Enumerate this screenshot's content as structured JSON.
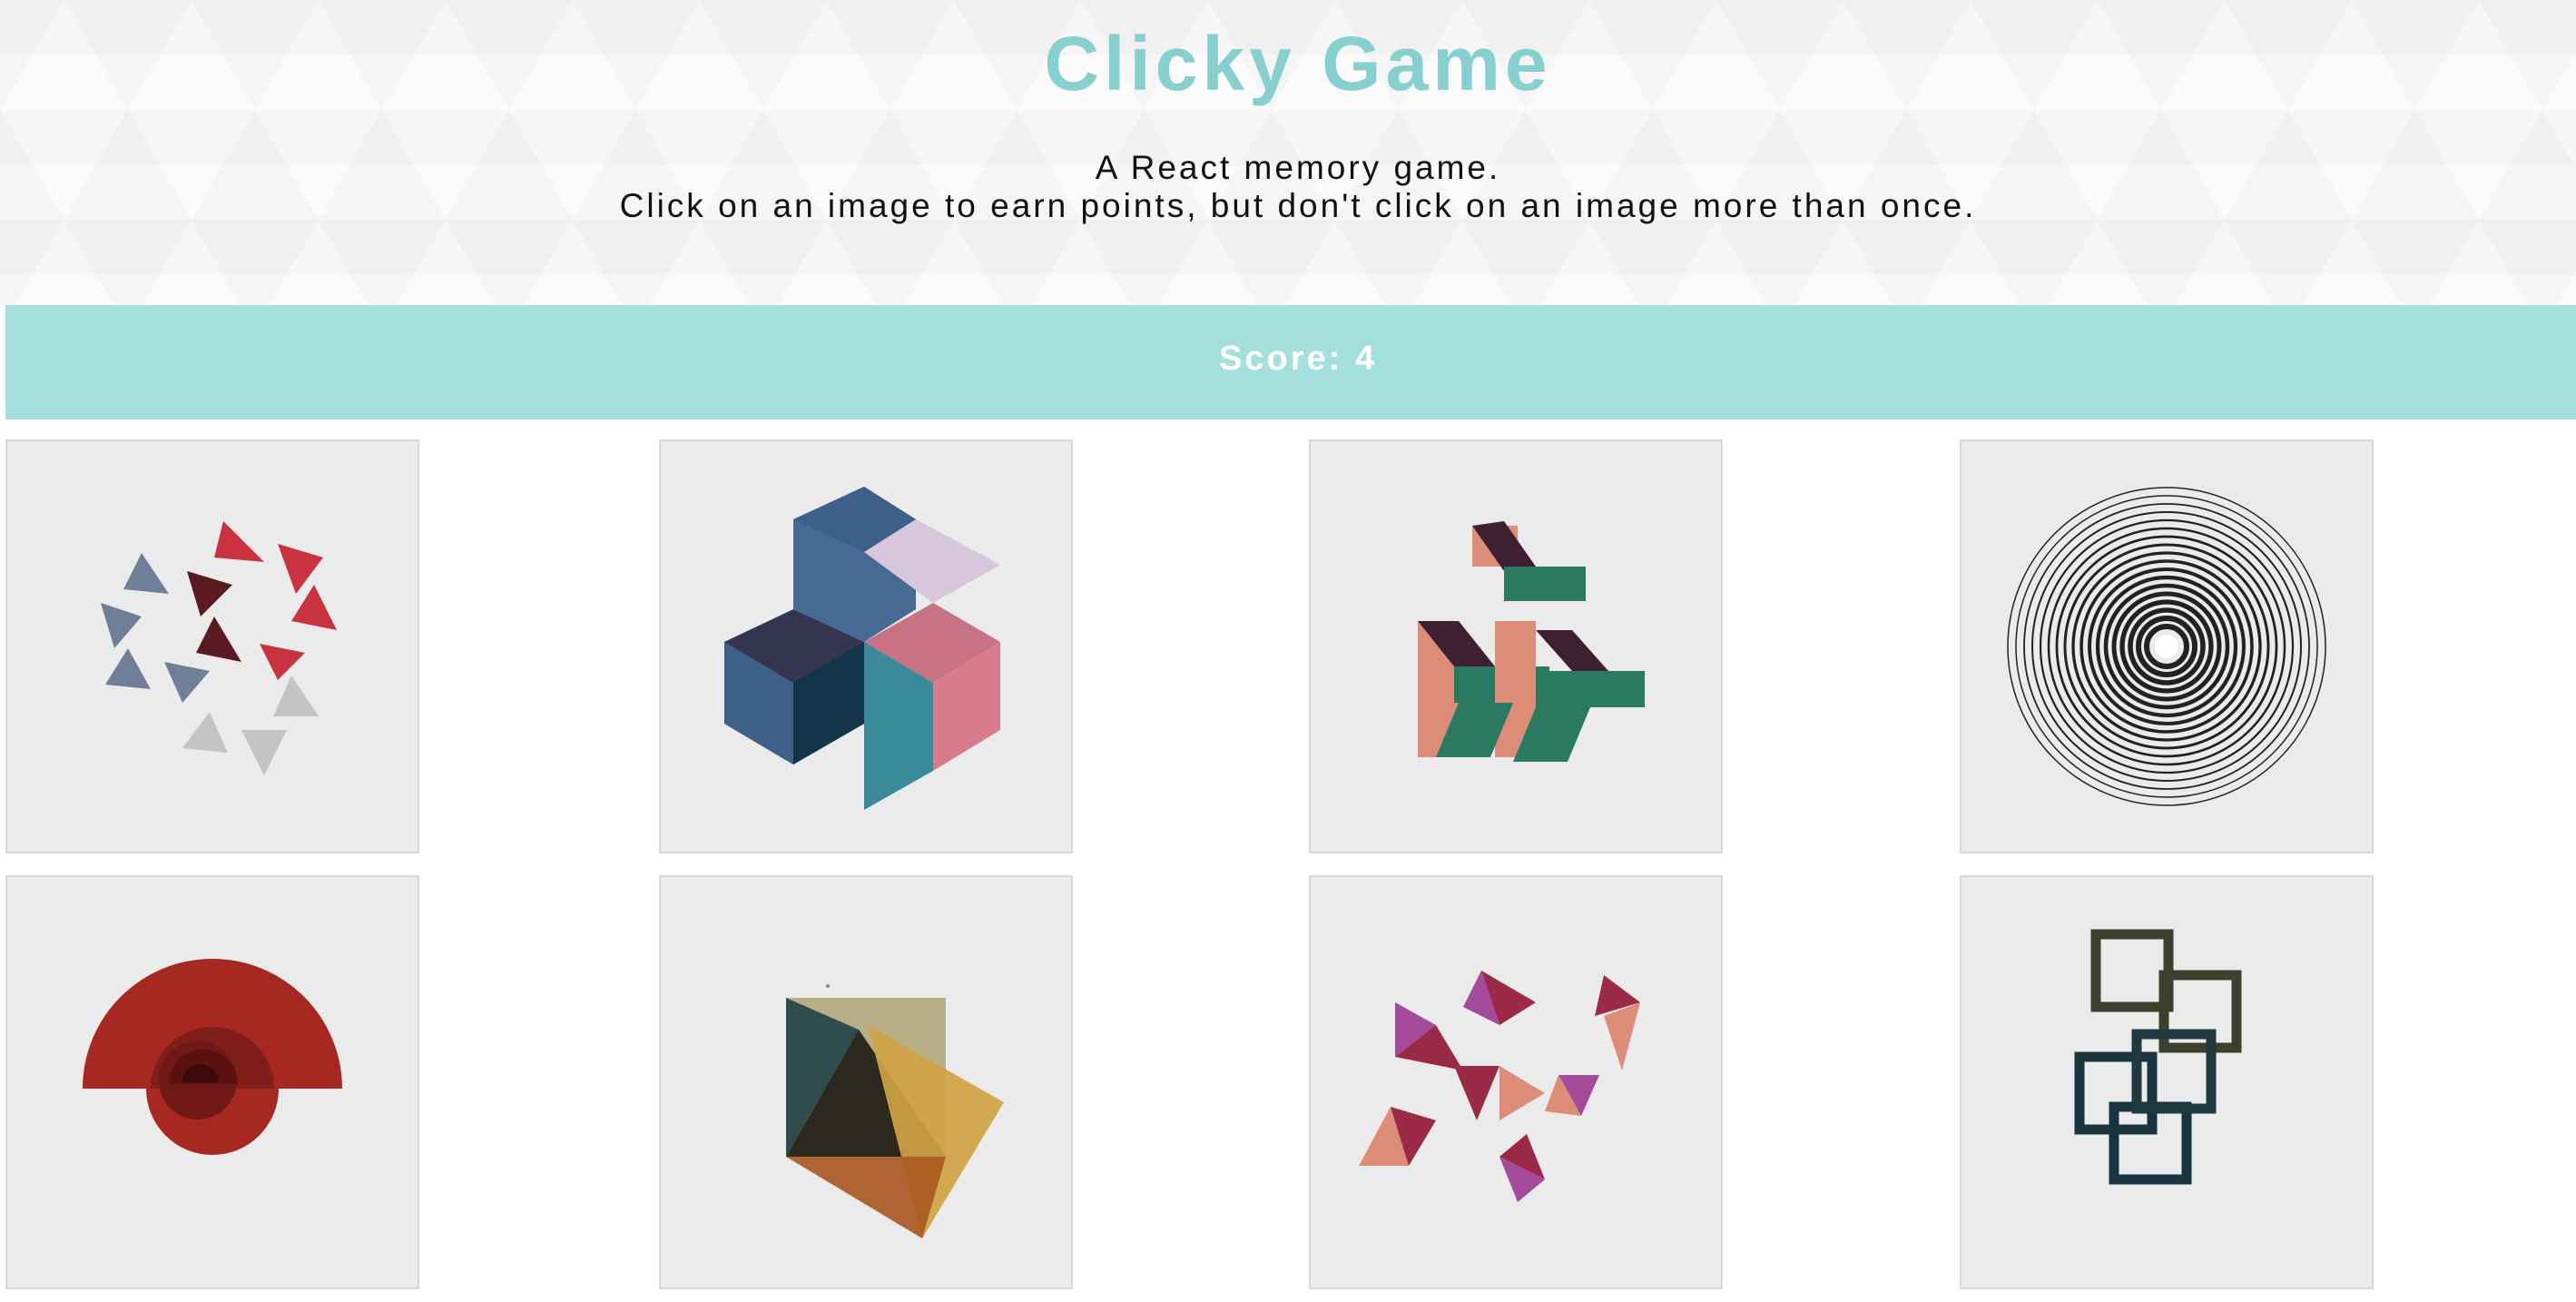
{
  "header": {
    "title": "Clicky Game",
    "subtitle_line1": "A React memory game.",
    "subtitle_line2": "Click on an image to earn points, but don't click on an image more than once."
  },
  "score": {
    "label": "Score: 4",
    "value": 4
  },
  "colors": {
    "accent": "#86d0cf",
    "score_bar": "#a3dfdd",
    "card_bg": "#ebebeb"
  },
  "cards": [
    {
      "name": "triangles-art"
    },
    {
      "name": "cubes-art"
    },
    {
      "name": "chevron-blocks-art"
    },
    {
      "name": "concentric-circles-art"
    },
    {
      "name": "half-circle-art"
    },
    {
      "name": "square-triangles-art"
    },
    {
      "name": "pink-triangles-art"
    },
    {
      "name": "linked-squares-art"
    }
  ]
}
